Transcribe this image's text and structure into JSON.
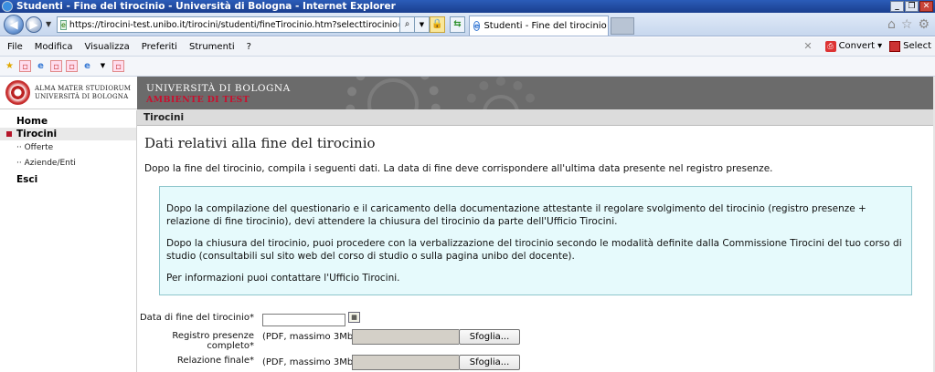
{
  "window": {
    "title": "Studenti - Fine del tirocinio - Università di Bologna - Internet Explorer"
  },
  "browser": {
    "url": "https://tirocini-test.unibo.it/tirocini/studenti/fineTirocinio.htm?selecttirocinio=11325&backUF",
    "tab_title": "Studenti - Fine del tirocinio - ...",
    "menu": [
      "File",
      "Modifica",
      "Visualizza",
      "Preferiti",
      "Strumenti",
      "?"
    ],
    "convert_label": "Convert",
    "select_label": "Select"
  },
  "logo": {
    "line1": "ALMA MATER STUDIORUM",
    "line2": "UNIVERSITÀ DI BOLOGNA"
  },
  "banner": {
    "university": "UNIVERSITÀ DI BOLOGNA",
    "environment": "AMBIENTE DI TEST"
  },
  "nav": {
    "home": "Home",
    "tirocini": "Tirocini",
    "offerte": "·· Offerte",
    "aziende": "·· Aziende/Enti",
    "esci": "Esci"
  },
  "breadcrumb": "Tirocini",
  "main": {
    "title": "Dati relativi alla fine del tirocinio",
    "intro": "Dopo la fine del tirocinio, compila i seguenti dati. La data di fine deve corrispondere all'ultima data presente nel registro presenze.",
    "info": [
      "Dopo la compilazione del questionario e il caricamento della documentazione attestante il regolare svolgimento del tirocinio (registro presenze + relazione di fine tirocinio), devi attendere la chiusura del tirocinio da parte dell'Ufficio Tirocini.",
      "Dopo la chiusura del tirocinio, puoi procedere con la verbalizzazione del tirocinio secondo le modalità definite dalla Commissione Tirocini del tuo corso di studio (consultabili sul sito web del corso di studio o sulla pagina unibo del docente).",
      "Per informazioni puoi contattare l'Ufficio Tirocini."
    ]
  },
  "form": {
    "date_label": "Data di fine del tirocinio*",
    "date_value": "",
    "registro_label_1": "Registro presenze",
    "registro_label_2": "completo*",
    "relazione_label": "Relazione finale*",
    "pdf_hint": "(PDF, massimo 3Mb)",
    "browse_label": "Sfoglia..."
  }
}
